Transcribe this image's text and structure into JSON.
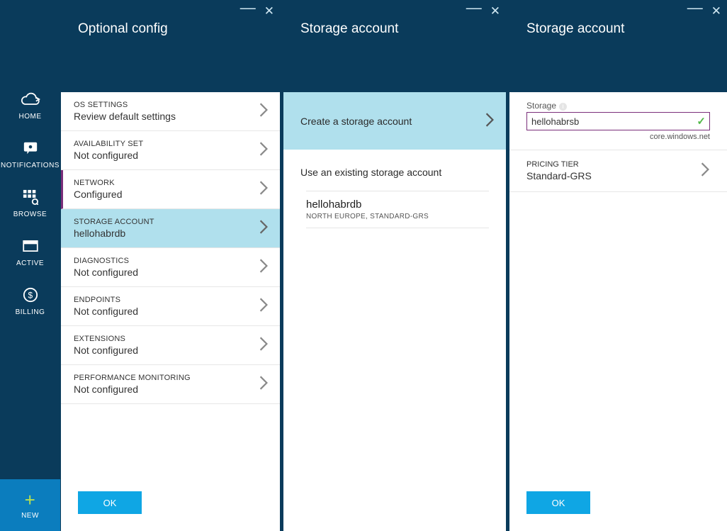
{
  "sidebar": {
    "items": [
      {
        "label": "HOME",
        "icon": "cloud-icon"
      },
      {
        "label": "NOTIFICATIONS",
        "icon": "notification-icon"
      },
      {
        "label": "BROWSE",
        "icon": "grid-icon"
      },
      {
        "label": "ACTIVE",
        "icon": "window-icon"
      },
      {
        "label": "BILLING",
        "icon": "billing-icon"
      }
    ],
    "new_label": "NEW"
  },
  "blade1": {
    "title": "Optional config",
    "rows": [
      {
        "label": "OS SETTINGS",
        "value": "Review default settings"
      },
      {
        "label": "AVAILABILITY SET",
        "value": "Not configured"
      },
      {
        "label": "NETWORK",
        "value": "Configured"
      },
      {
        "label": "STORAGE ACCOUNT",
        "value": "hellohabrdb"
      },
      {
        "label": "DIAGNOSTICS",
        "value": "Not configured"
      },
      {
        "label": "ENDPOINTS",
        "value": "Not configured"
      },
      {
        "label": "EXTENSIONS",
        "value": "Not configured"
      },
      {
        "label": "PERFORMANCE MONITORING",
        "value": "Not configured"
      }
    ],
    "ok": "OK"
  },
  "blade2": {
    "title": "Storage account",
    "create": "Create a storage account",
    "existing_header": "Use an existing storage account",
    "existing": {
      "name": "hellohabrdb",
      "meta": "NORTH EUROPE, STANDARD-GRS"
    }
  },
  "blade3": {
    "title": "Storage account",
    "storage_label": "Storage",
    "storage_value": "hellohabrsb",
    "suffix": "core.windows.net",
    "tier_label": "PRICING TIER",
    "tier_value": "Standard-GRS",
    "ok": "OK"
  }
}
